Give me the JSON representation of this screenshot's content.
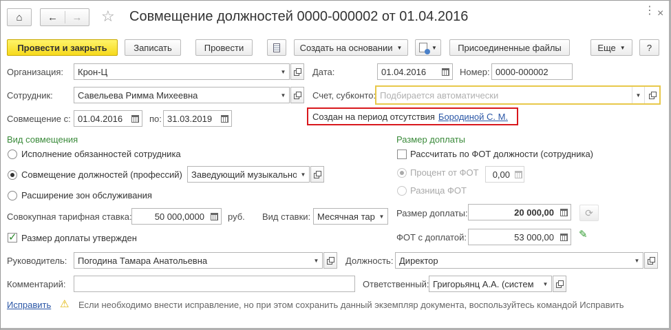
{
  "window": {
    "title": "Совмещение должностей 0000-000002 от 01.04.2016"
  },
  "toolbar": {
    "post_close": "Провести и закрыть",
    "save": "Записать",
    "post": "Провести",
    "create_based": "Создать на основании",
    "attached_files": "Присоединенные файлы",
    "more": "Еще",
    "help": "?"
  },
  "form": {
    "organization_label": "Организация:",
    "organization_value": "Крон-Ц",
    "date_label": "Дата:",
    "date_value": "01.04.2016",
    "number_label": "Номер:",
    "number_value": "0000-000002",
    "employee_label": "Сотрудник:",
    "employee_value": "Савельева Римма Михеевна",
    "account_label": "Счет, субконто:",
    "account_placeholder": "Подбирается автоматически",
    "combo_from_label": "Совмещение с:",
    "combo_from_value": "01.04.2016",
    "combo_to_label": "по:",
    "combo_to_value": "31.03.2019",
    "absence_text": "Создан на период отсутствия",
    "absence_link": "Бородиной С. М."
  },
  "combination": {
    "header": "Вид совмещения",
    "opt1": "Исполнение обязанностей сотрудника",
    "opt2": "Совмещение должностей (профессий)",
    "opt2_position": "Заведующий музыкально",
    "opt3": "Расширение зон обслуживания",
    "selected": "opt2"
  },
  "payment": {
    "header": "Размер доплаты",
    "calc_fot": "Рассчитать по ФОТ должности (сотрудника)",
    "percent_label": "Процент от ФОТ",
    "percent_value": "0,00",
    "diff_label": "Разница ФОТ",
    "amount_label": "Размер доплаты:",
    "amount_value": "20 000,00",
    "fot_label": "ФОТ с доплатой:",
    "fot_value": "53 000,00"
  },
  "rates": {
    "total_rate_label": "Совокупная тарифная ставка:",
    "total_rate_value": "50 000,0000",
    "currency": "руб.",
    "rate_type_label": "Вид ставки:",
    "rate_type_value": "Месячная тар",
    "approved_label": "Размер доплаты утвержден",
    "approved": true
  },
  "footer": {
    "manager_label": "Руководитель:",
    "manager_value": "Погодина Тамара Анатольевна",
    "position_label": "Должность:",
    "position_value": "Директор",
    "comment_label": "Комментарий:",
    "comment_value": "",
    "responsible_label": "Ответственный:",
    "responsible_value": "Григорьянц А.А. (систем",
    "fix_link": "Исправить",
    "fix_hint": "Если необходимо внести исправление, но при этом сохранить данный экземпляр документа, воспользуйтесь командой Исправить"
  },
  "colors": {
    "accent_yellow": "#f6d91c",
    "green_header": "#3a8a3a",
    "absence_border": "#d8171c",
    "account_border": "#e8c84a"
  }
}
